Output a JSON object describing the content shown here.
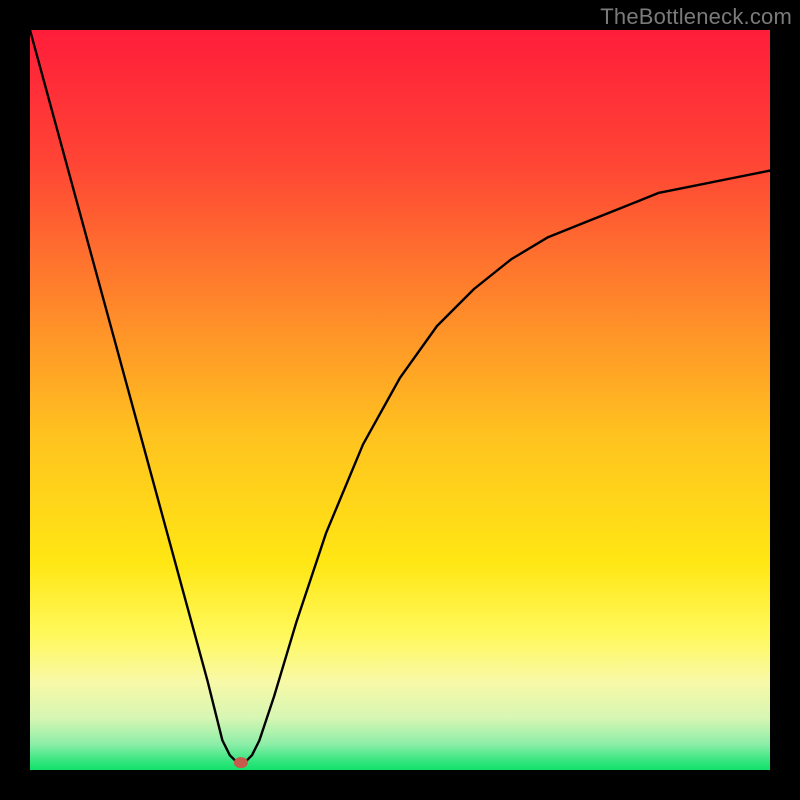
{
  "watermark": "TheBottleneck.com",
  "chart_data": {
    "type": "line",
    "title": "",
    "xlabel": "",
    "ylabel": "",
    "xlim": [
      0,
      100
    ],
    "ylim": [
      0,
      100
    ],
    "grid": false,
    "series": [
      {
        "name": "curve",
        "x": [
          0,
          3,
          6,
          9,
          12,
          15,
          18,
          21,
          24,
          26,
          27,
          28,
          29,
          30,
          31,
          33,
          36,
          40,
          45,
          50,
          55,
          60,
          65,
          70,
          75,
          80,
          85,
          90,
          95,
          100
        ],
        "y": [
          100,
          89,
          78,
          67,
          56,
          45,
          34,
          23,
          12,
          4,
          2,
          1,
          1,
          2,
          4,
          10,
          20,
          32,
          44,
          53,
          60,
          65,
          69,
          72,
          74,
          76,
          78,
          79,
          80,
          81
        ]
      }
    ],
    "marker": {
      "x": 28.5,
      "y": 1
    },
    "background_gradient": {
      "stops": [
        {
          "offset": 0.0,
          "color": "#ff1d3a"
        },
        {
          "offset": 0.18,
          "color": "#ff4535"
        },
        {
          "offset": 0.38,
          "color": "#ff8a2a"
        },
        {
          "offset": 0.55,
          "color": "#ffc31f"
        },
        {
          "offset": 0.72,
          "color": "#ffe714"
        },
        {
          "offset": 0.82,
          "color": "#fff95e"
        },
        {
          "offset": 0.88,
          "color": "#f8f9a7"
        },
        {
          "offset": 0.93,
          "color": "#d7f6b4"
        },
        {
          "offset": 0.965,
          "color": "#8ceea8"
        },
        {
          "offset": 0.99,
          "color": "#2de57b"
        },
        {
          "offset": 1.0,
          "color": "#13e06a"
        }
      ]
    }
  }
}
